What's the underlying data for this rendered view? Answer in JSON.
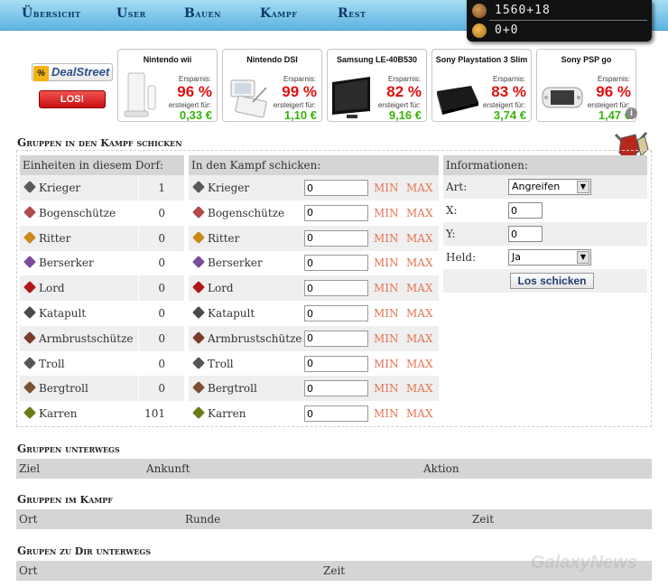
{
  "nav": {
    "items": [
      {
        "id": "uebersicht",
        "label": "Übersicht"
      },
      {
        "id": "user",
        "label": "User"
      },
      {
        "id": "bauen",
        "label": "Bauen"
      },
      {
        "id": "kampf",
        "label": "Kampf"
      },
      {
        "id": "rest",
        "label": "Rest"
      }
    ]
  },
  "resources": {
    "row1": {
      "icon": "horse-icon",
      "value": "1560+18"
    },
    "row2": {
      "icon": "gold-coin-icon",
      "value": "0+0"
    }
  },
  "ad": {
    "logo": "DealStreet",
    "logo_symbol": "%",
    "cta": "LOS!",
    "info_symbol": "i",
    "products": [
      {
        "name": "Nintendo wii",
        "savings_label": "Ersparnis:",
        "percent": "96 %",
        "price_label": "ersteigert für:",
        "price": "0,33 €"
      },
      {
        "name": "Nintendo DSI",
        "savings_label": "Ersparnis:",
        "percent": "99 %",
        "price_label": "ersteigert für:",
        "price": "1,10 €"
      },
      {
        "name": "Samsung LE-40B530",
        "savings_label": "Ersparnis:",
        "percent": "82 %",
        "price_label": "ersteigert für:",
        "price": "9,16 €"
      },
      {
        "name": "Sony Playstation 3 Slim",
        "savings_label": "Ersparnis:",
        "percent": "83 %",
        "price_label": "ersteigert für:",
        "price": "3,74 €"
      },
      {
        "name": "Sony PSP go",
        "savings_label": "Ersparnis:",
        "percent": "96 %",
        "price_label": "ersteigert für:",
        "price": "1,47 €"
      }
    ]
  },
  "fight": {
    "title": "Gruppen in den Kampf schicken",
    "col_units": "Einheiten in diesem Dorf:",
    "col_send": "In den Kampf schicken:",
    "col_info": "Informationen:",
    "min_label": "MIN",
    "max_label": "MAX",
    "units": [
      {
        "name": "Krieger",
        "count": "1",
        "send": "0",
        "icon": "axe-icon"
      },
      {
        "name": "Bogenschütze",
        "count": "0",
        "send": "0",
        "icon": "bow-icon"
      },
      {
        "name": "Ritter",
        "count": "0",
        "send": "0",
        "icon": "knight-helmet-icon"
      },
      {
        "name": "Berserker",
        "count": "0",
        "send": "0",
        "icon": "sword-icon"
      },
      {
        "name": "Lord",
        "count": "0",
        "send": "0",
        "icon": "dagger-icon"
      },
      {
        "name": "Katapult",
        "count": "0",
        "send": "0",
        "icon": "catapult-icon"
      },
      {
        "name": "Armbrustschütze",
        "count": "0",
        "send": "0",
        "icon": "crossbowman-icon"
      },
      {
        "name": "Troll",
        "count": "0",
        "send": "0",
        "icon": "troll-icon"
      },
      {
        "name": "Bergtroll",
        "count": "0",
        "send": "0",
        "icon": "mountain-troll-icon"
      },
      {
        "name": "Karren",
        "count": "101",
        "send": "0",
        "icon": "cart-icon"
      }
    ],
    "info": {
      "art_label": "Art:",
      "art_value": "Angreifen",
      "x_label": "X:",
      "x_value": "0",
      "y_label": "Y:",
      "y_value": "0",
      "held_label": "Held:",
      "held_value": "Ja",
      "send_button": "Los schicken"
    }
  },
  "underway": {
    "title": "Gruppen unterwegs",
    "columns": [
      "Ziel",
      "Ankunft",
      "Aktion"
    ]
  },
  "infight": {
    "title": "Gruppen im Kampf",
    "columns": [
      "Ort",
      "Runde",
      "Zeit"
    ]
  },
  "incoming": {
    "title": "Grupen zu Dir unterwegs",
    "columns": [
      "Ort",
      "Zeit"
    ]
  },
  "watermark": "GalaxyNews",
  "colors": {
    "accent_min_max": "#e67452",
    "nav_bg": "#79c4ea",
    "ad_percent": "#e01010",
    "ad_price": "#37b30a"
  }
}
